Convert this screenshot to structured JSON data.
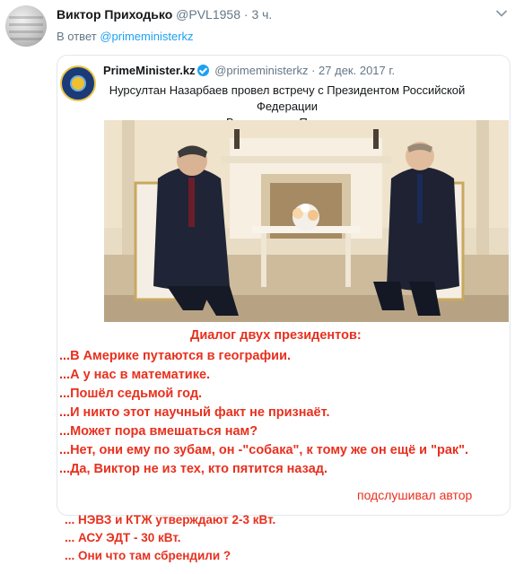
{
  "tweet": {
    "author_name": "Виктор Приходько",
    "author_handle": "@PVL1958",
    "separator": "·",
    "time": "3 ч.",
    "reply_prefix": "В ответ",
    "reply_mention": "@primeministerkz"
  },
  "quoted": {
    "author_name": "PrimeMinister.kz",
    "author_handle": "@primeministerkz",
    "separator": "·",
    "date": "27 дек. 2017 г.",
    "text_line1": "Нурсултан Назарбаев провел встречу с Президентом Российской Федерации",
    "text_line2": "Владимиром Путиным",
    "dialog_title": "Диалог двух президентов:",
    "dialog_lines": [
      "...В Америке путаются в географии.",
      "...А у нас в математике.",
      "...Пошёл седьмой год.",
      "...И никто этот научный факт не признаёт.",
      "...Может пора вмешаться нам?",
      "...Нет, они ему по зубам, он -\"собака\", к тому же он ещё и \"рак\".",
      "...Да, Виктор не из тех, кто пятится назад."
    ],
    "signature": "подслушивал автор"
  },
  "comments": [
    "... НЭВЗ и КТЖ утверждают 2-3 кВт.",
    "... АСУ ЭДТ - 30 кВт.",
    "... Они что там сбрендили ?"
  ],
  "colors": {
    "accent": "#1da1f2",
    "secondary_text": "#657786",
    "dialog_red": "#e8301e"
  },
  "icons": {
    "menu": "chevron-down-icon",
    "verified": "verified-badge-icon"
  }
}
